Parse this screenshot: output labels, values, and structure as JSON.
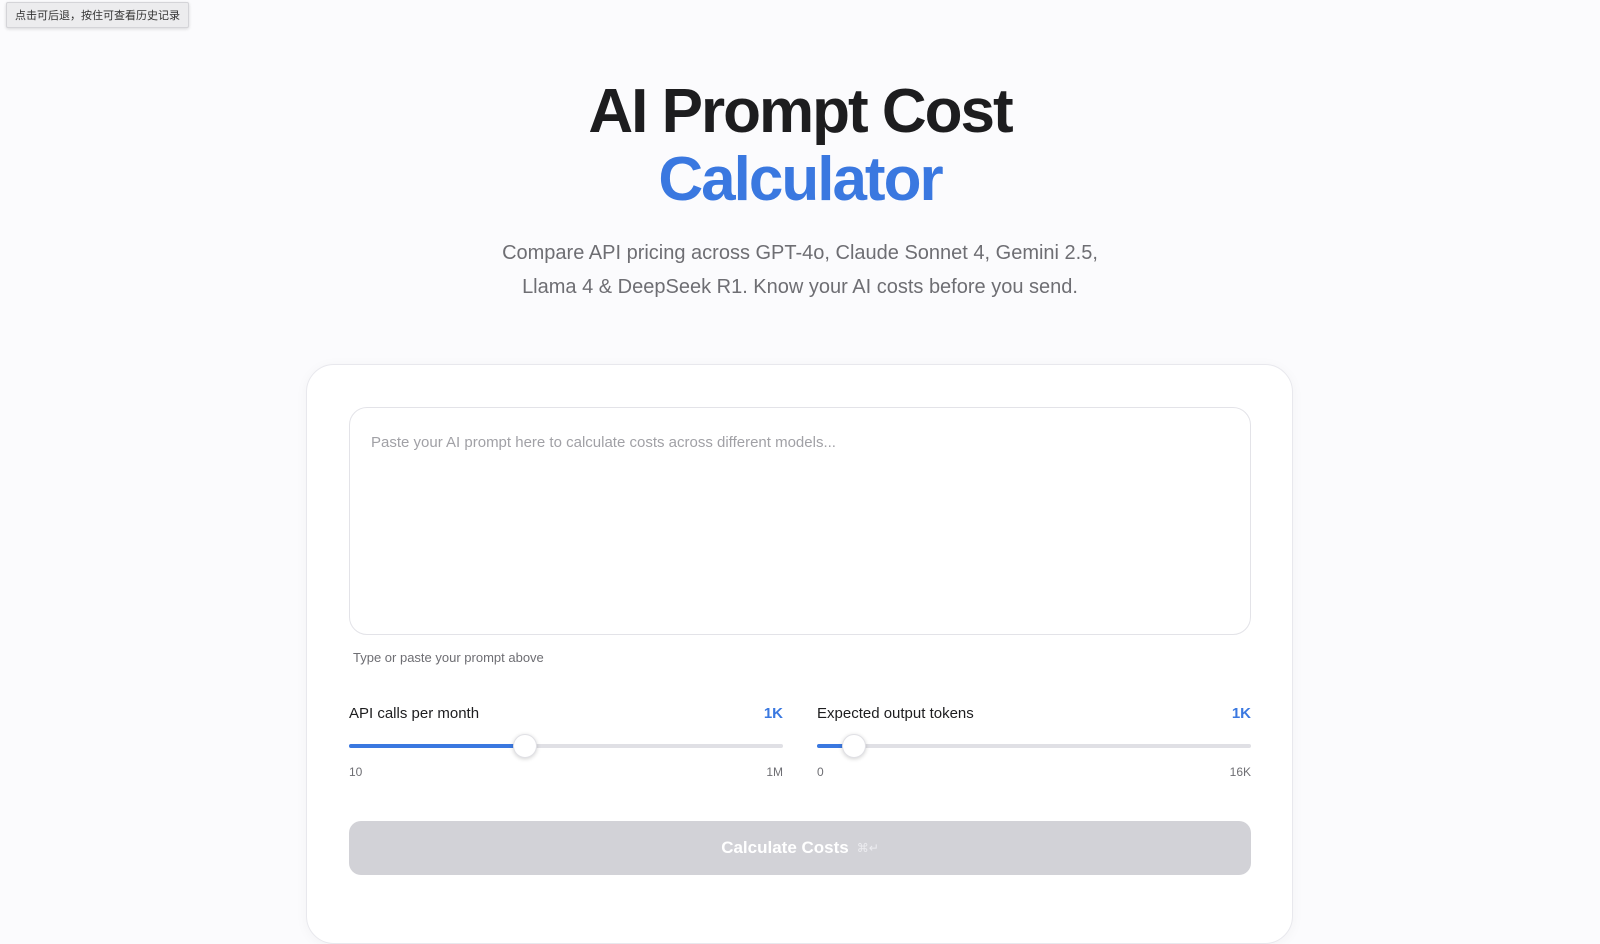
{
  "tooltip": "点击可后退，按住可查看历史记录",
  "hero": {
    "title_line1": "AI Prompt Cost",
    "title_line2": "Calculator",
    "subtitle": "Compare API pricing across GPT-4o, Claude Sonnet 4, Gemini 2.5, Llama 4 & DeepSeek R1. Know your AI costs before you send."
  },
  "prompt": {
    "placeholder": "Paste your AI prompt here to calculate costs across different models...",
    "value": "",
    "hint": "Type or paste your prompt above"
  },
  "sliders": {
    "api_calls": {
      "label": "API calls per month",
      "value_label": "1K",
      "min_label": "10",
      "max_label": "1M",
      "fill_fraction": 0.405
    },
    "output_tokens": {
      "label": "Expected output tokens",
      "value_label": "1K",
      "min_label": "0",
      "max_label": "16K",
      "fill_fraction": 0.085
    }
  },
  "calculate_button": {
    "label": "Calculate Costs",
    "shortcut": "⌘↵",
    "enabled": false
  },
  "colors": {
    "accent": "#3a78e0",
    "button_disabled": "#d2d2d7",
    "background": "#fbfbfd"
  }
}
